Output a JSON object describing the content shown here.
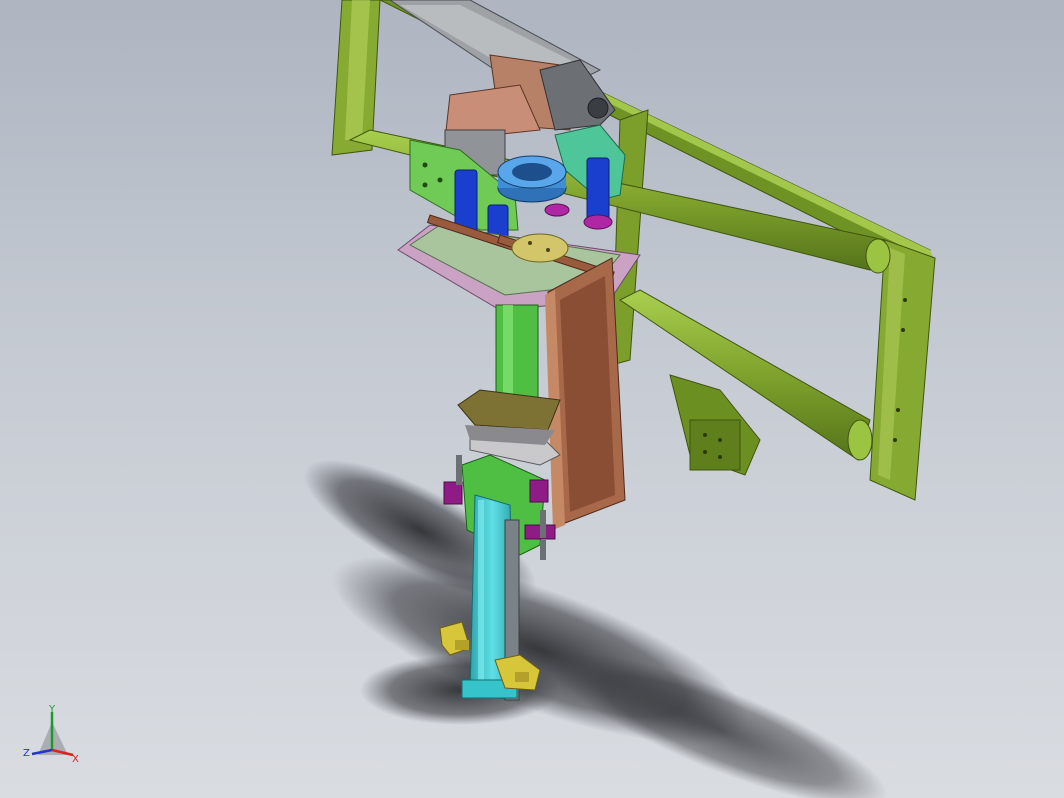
{
  "viewport": {
    "kind": "3D CAD assembly viewport",
    "model_colors": {
      "frame": "#7fa22c",
      "frame_dark": "#4f6b14",
      "slide": "#36c3c9",
      "plate_pink": "#c9a2c4",
      "bracket_brown": "#9a5a3e",
      "cylinder_blue": "#1a3fcf",
      "ring_blue": "#3f8ed6",
      "pad_magenta": "#b027a6",
      "gripper_yellow": "#d7c63a"
    }
  },
  "triad": {
    "x_label": "X",
    "y_label": "Y",
    "z_label": "Z",
    "x_color": "#d9241e",
    "y_color": "#1f9a2a",
    "z_color": "#2334c9"
  }
}
